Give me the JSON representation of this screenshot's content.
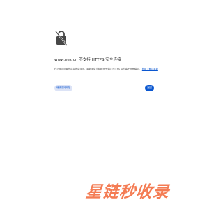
{
  "page": {
    "heading": "www.nez.cn 不支持 HTTPS 安全连接",
    "body_text": "在正常访问者的真实信息显示，重新加载当前网页不支持 HTTPS 后的端子页面模式。",
    "learn_more_link": "获取了解以重新"
  },
  "buttons": {
    "secondary_label": "继续访问网站",
    "primary_label": "返回"
  },
  "watermark": {
    "text": "星链秒收录"
  },
  "colors": {
    "accent": "#0b57d0",
    "secondary_button_bg": "#dce3f6",
    "watermark": "#f47c54",
    "text": "#1f1f1f"
  },
  "icons": {
    "lock": "lock-crossed-icon"
  }
}
